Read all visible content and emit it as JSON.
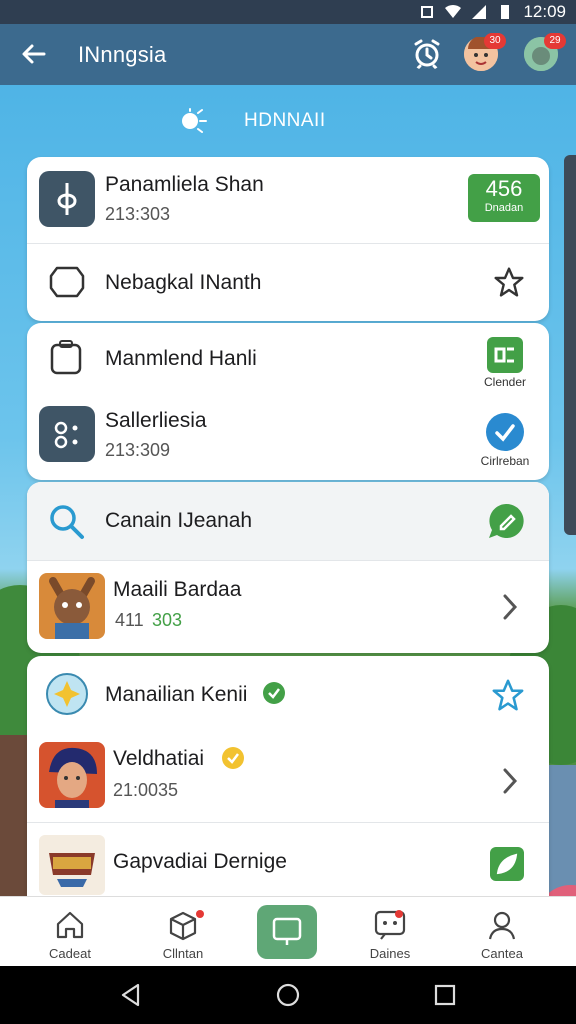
{
  "status": {
    "time": "12:09"
  },
  "appbar": {
    "title": "INnngsia",
    "avatar1_badge": "30",
    "avatar2_badge": "29"
  },
  "subhead": {
    "text": "HDNNAII"
  },
  "cards": {
    "c1": {
      "row1": {
        "title": "Panamliela Shan",
        "sub": "213:303",
        "pill_value": "456",
        "pill_label": "Dnadan"
      },
      "row2": {
        "title": "Nebagkal INanth"
      }
    },
    "c2": {
      "row1": {
        "title": "Manmlend Hanli",
        "cap": "Clender"
      },
      "row2": {
        "title": "Sallerliesia",
        "sub": "213:309",
        "cap": "Cirlreban"
      }
    },
    "c3": {
      "row1": {
        "title": "Canain IJeanah"
      },
      "row2": {
        "title": "Maaili Bardaa",
        "sub_a": "411",
        "sub_b": "303"
      }
    },
    "c4": {
      "row1": {
        "title": "Manailian Kenii"
      },
      "row2": {
        "title": "Veldhatiai",
        "sub": "21:0035"
      },
      "row3": {
        "title": "Gapvadiai Dernige"
      }
    }
  },
  "bottomnav": {
    "items": [
      {
        "label": "Cadeat"
      },
      {
        "label": "Cllntan"
      },
      {
        "label": ""
      },
      {
        "label": "Daines"
      },
      {
        "label": "Cantea"
      }
    ]
  },
  "colors": {
    "accent": "#3c6a8e",
    "green": "#43a047",
    "blue": "#2a8ad0",
    "badge": "#e53935"
  }
}
